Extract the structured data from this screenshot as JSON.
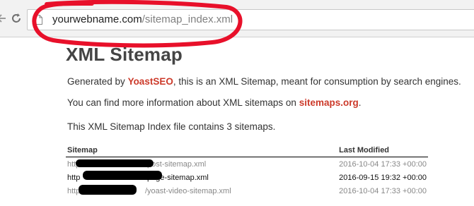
{
  "browser": {
    "url_host": "yourwebname.com",
    "url_path": "/sitemap_index.xml"
  },
  "page": {
    "title": "XML Sitemap",
    "generated_prefix": "Generated by ",
    "generated_link": "YoastSEO",
    "generated_suffix": ", this is an XML Sitemap, meant for consumption by search engines.",
    "info_prefix": "You can find more information about XML sitemaps on ",
    "info_link": "sitemaps.org",
    "info_suffix": ".",
    "count_text": "This XML Sitemap Index file contains 3 sitemaps."
  },
  "table": {
    "headers": [
      "Sitemap",
      "Last Modified"
    ],
    "rows": [
      {
        "loc_prefix": "http",
        "loc_suffix": "/post-sitemap.xml",
        "lastmod": "2016-10-04 17:33 +00:00"
      },
      {
        "loc_prefix": "http",
        "loc_suffix": "/page-sitemap.xml",
        "lastmod": "2016-09-15 19:32 +00:00"
      },
      {
        "loc_prefix": "http",
        "loc_suffix": "/yoast-video-sitemap.xml",
        "lastmod": "2016-10-04 17:33 +00:00"
      }
    ]
  },
  "colors": {
    "link": "#cc3a2a",
    "annotation": "#e8102a"
  },
  "icons": [
    "back-arrow-icon",
    "reload-icon",
    "page-icon"
  ]
}
